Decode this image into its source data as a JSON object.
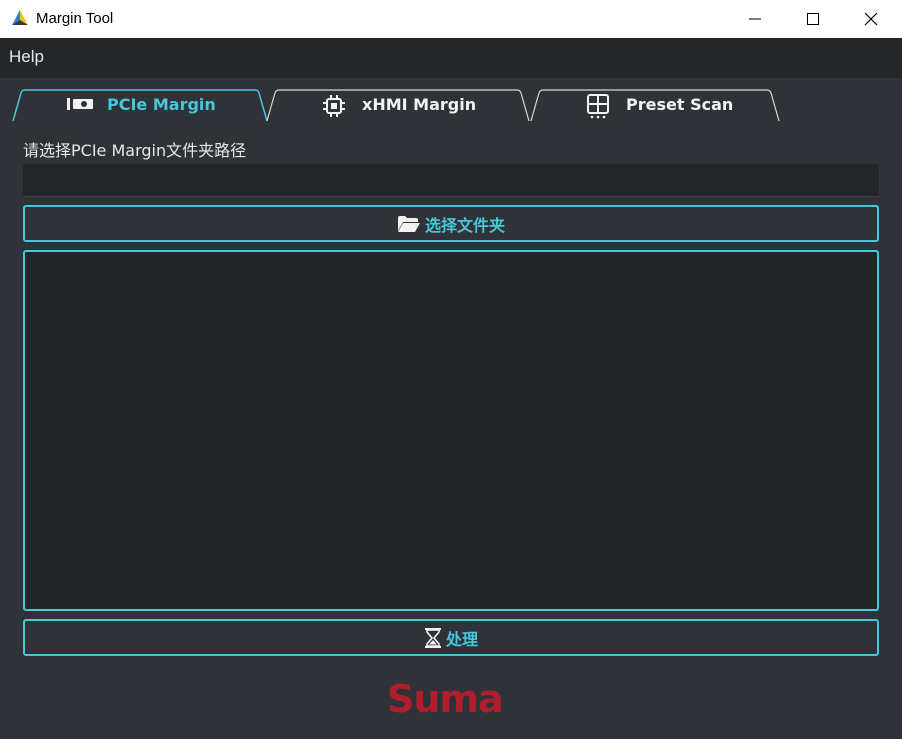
{
  "window": {
    "title": "Margin Tool"
  },
  "menu": {
    "help_label": "Help"
  },
  "tabs": [
    {
      "label": "PCIe Margin",
      "icon": "pcie-card-icon",
      "active": true
    },
    {
      "label": "xHMI Margin",
      "icon": "chip-icon",
      "active": false
    },
    {
      "label": "Preset Scan",
      "icon": "grid-icon",
      "active": false
    }
  ],
  "pcie": {
    "path_label": "请选择PCIe Margin文件夹路径",
    "path_value": "",
    "select_button": "选择文件夹",
    "select_icon": "folder-open-icon",
    "output_text": "",
    "process_button": "处理",
    "process_icon": "hourglass-icon"
  },
  "footer": {
    "logo_text": "Suma"
  },
  "colors": {
    "accent": "#45c8dc",
    "background": "#2f3337",
    "menubar": "#23272a",
    "logo": "#b01e2c"
  }
}
